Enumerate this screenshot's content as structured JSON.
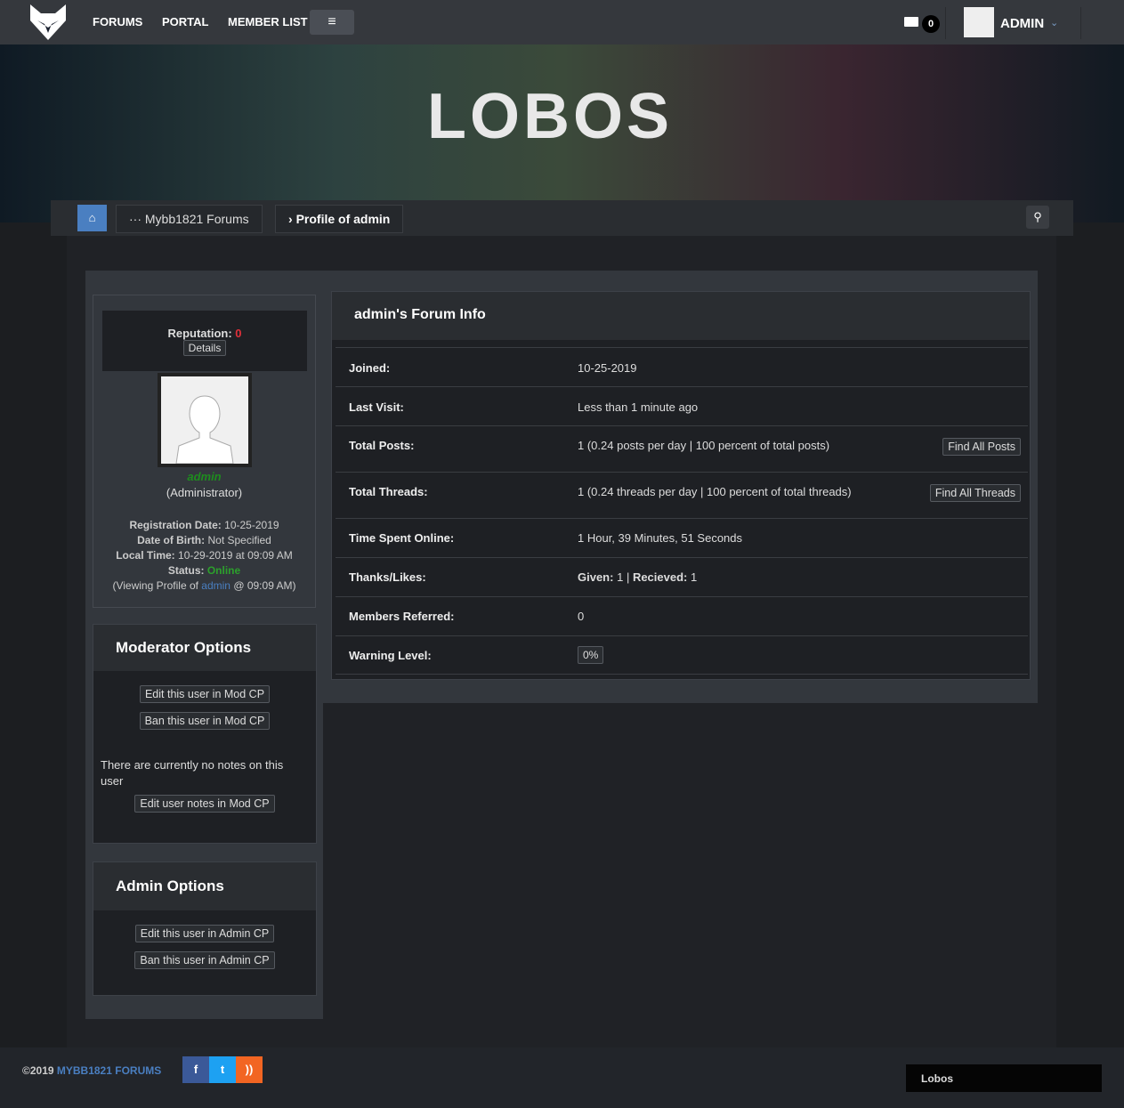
{
  "nav": {
    "links": [
      "FORUMS",
      "PORTAL",
      "MEMBER LIST"
    ],
    "pm_count": "0",
    "user": "ADMIN"
  },
  "banner": {
    "logo": "LOBOS"
  },
  "breadcrumb": [
    "Mybb1821 Forums",
    "Profile of admin"
  ],
  "profile": {
    "reputation_label": "Reputation:",
    "reputation": "0",
    "details": "Details",
    "username": "admin",
    "usertitle": "(Administrator)",
    "reg_label": "Registration Date:",
    "reg": "10-25-2019",
    "dob_label": "Date of Birth:",
    "dob": "Not Specified",
    "lt_label": "Local Time:",
    "lt": "10-29-2019 at 09:09 AM",
    "status_label": "Status:",
    "status": "Online",
    "viewing_pre": "(Viewing Profile of ",
    "viewing_user": "admin",
    "viewing_post": " @ 09:09 AM)"
  },
  "mod": {
    "title": "Moderator Options",
    "edit": "Edit this user in Mod CP",
    "ban": "Ban this user in Mod CP",
    "notes": "There are currently no notes on this user",
    "edit_notes": "Edit user notes in Mod CP"
  },
  "admin": {
    "title": "Admin Options",
    "edit": "Edit this user in Admin CP",
    "ban": "Ban this user in Admin CP"
  },
  "info": {
    "title": "admin's Forum Info",
    "rows": [
      {
        "k": "Joined:",
        "v": "10-25-2019"
      },
      {
        "k": "Last Visit:",
        "v": "Less than 1 minute ago"
      },
      {
        "k": "Total Posts:",
        "v": "1 (0.24 posts per day | 100 percent of total posts)",
        "btn": "Find All Posts"
      },
      {
        "k": "Total Threads:",
        "v": "1 (0.24 threads per day | 100 percent of total threads)",
        "btn": "Find All Threads"
      },
      {
        "k": "Time Spent Online:",
        "v": "1 Hour, 39 Minutes, 51 Seconds"
      },
      {
        "k": "Thanks/Likes:",
        "given_label": "Given:",
        "given": "1",
        "rec_label": "Recieved:",
        "rec": "1"
      },
      {
        "k": "Members Referred:",
        "v": "0"
      },
      {
        "k": "Warning Level:",
        "badge": "0%"
      }
    ]
  },
  "footer": {
    "copy": "©2019 ",
    "site": "MYBB1821 FORUMS",
    "theme": "Lobos"
  }
}
